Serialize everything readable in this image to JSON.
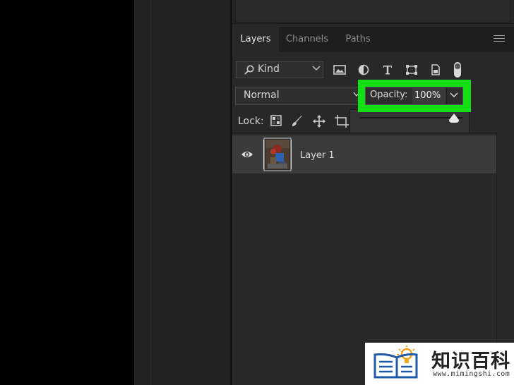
{
  "panel": {
    "tabs": [
      {
        "label": "Layers",
        "active": true
      },
      {
        "label": "Channels",
        "active": false
      },
      {
        "label": "Paths",
        "active": false
      }
    ]
  },
  "filter": {
    "kind_label": "Kind",
    "icons": [
      "pixel-filter-icon",
      "adjustment-filter-icon",
      "type-filter-icon",
      "shape-filter-icon",
      "smart-object-filter-icon",
      "filter-toggle-icon"
    ]
  },
  "blend": {
    "mode": "Normal"
  },
  "opacity": {
    "label": "Opacity:",
    "value": "100%",
    "highlight_color": "#12e012"
  },
  "lock": {
    "label": "Lock:",
    "icons": [
      "lock-transparent-icon",
      "lock-image-icon",
      "lock-position-icon",
      "lock-artboard-icon"
    ]
  },
  "layers": [
    {
      "name": "Layer 1",
      "visible": true,
      "selected": true
    }
  ],
  "watermark": {
    "text": "知识百科",
    "url": "www.mimingshi.com"
  }
}
